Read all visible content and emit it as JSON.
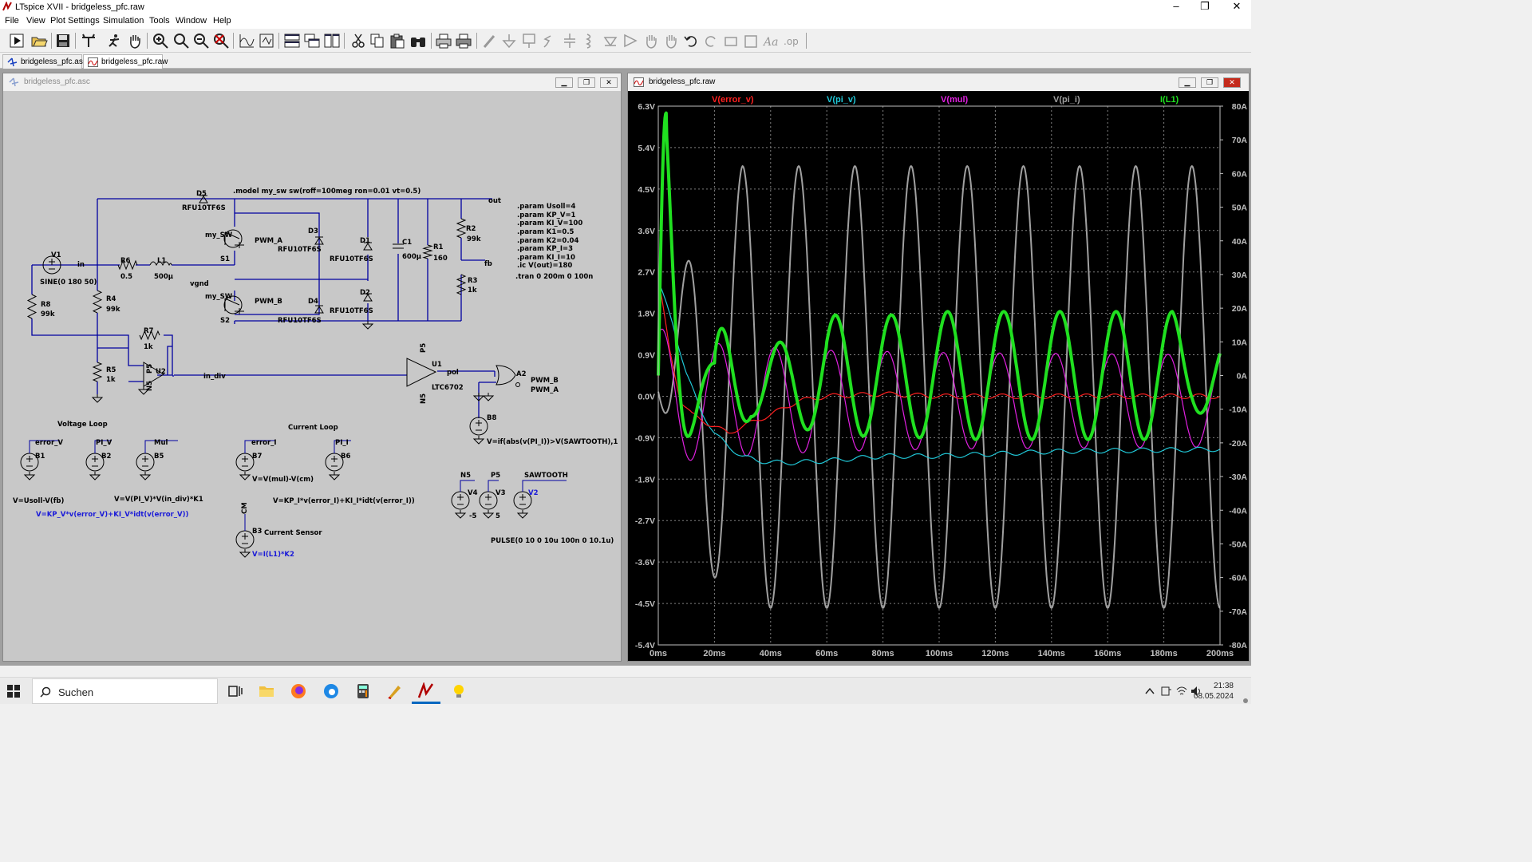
{
  "app": {
    "title": "LTspice XVII - bridgeless_pfc.raw"
  },
  "window_controls": {
    "minimize": "–",
    "maximize": "❐",
    "close": "✕"
  },
  "menu": [
    "File",
    "View",
    "Plot Settings",
    "Simulation",
    "Tools",
    "Window",
    "Help"
  ],
  "toolbar_icons": [
    "run-icon",
    "open-icon",
    "save-icon",
    "control-panel-icon",
    "halt-icon",
    "pan-icon",
    "zoom-in-icon",
    "zoom-to-fit-icon",
    "zoom-out-icon",
    "cancel-zoom-icon",
    "autorange-icon",
    "manual-limits-icon",
    "tile-horizontal-icon",
    "cascade-icon",
    "tile-vertical-icon",
    "cut-icon",
    "copy-icon",
    "paste-icon",
    "find-icon",
    "print-preview-icon",
    "print-icon",
    "wire-icon",
    "ground-icon",
    "label-icon",
    "resistor-icon",
    "capacitor-icon",
    "inductor-icon",
    "diode-icon",
    "component-icon",
    "move-icon",
    "drag-icon",
    "undo-icon",
    "redo-icon",
    "rotate-icon",
    "mirror-icon",
    "text-icon",
    "spice-directive-icon"
  ],
  "tabs": [
    {
      "label": "bridgeless_pfc.asc"
    },
    {
      "label": "bridgeless_pfc.raw"
    }
  ],
  "schematic": {
    "title": "bridgeless_pfc.asc",
    "texts": [
      ".model my_sw sw(roff=100meg ron=0.01 vt=0.5)",
      "D5",
      "RFU10TF6S",
      "out",
      ".param Usoll=4",
      ".param KP_V=1",
      ".param KI_V=100",
      ".param K1=0.5",
      ".param K2=0.04",
      ".param KP_I=3",
      ".param KI_I=10",
      ".ic V(out)=180",
      ".tran 0 200m 0 100n",
      "my_SW",
      "PWM_A",
      "S1",
      "D3",
      "RFU10TF6S",
      "D1",
      "RFU10TF6S",
      "C1",
      "600µ",
      "R1",
      "160",
      "R2",
      "99k",
      "fb",
      "R3",
      "1k",
      "V1",
      "in",
      "R6",
      "0.5",
      "L1",
      "500µ",
      "SINE(0 180 50)",
      "vgnd",
      "my_SW",
      "PWM_B",
      "S2",
      "D4",
      "RFU10TF6S",
      "D2",
      "RFU10TF6S",
      "R8",
      "99k",
      "R4",
      "99k",
      "R7",
      "1k",
      "R5",
      "1k",
      "U2",
      "in_div",
      "P5",
      "N5",
      "U1",
      "pol",
      "LTC6702",
      "P5",
      "N5",
      "A2",
      "PWM_B",
      "PWM_A",
      "B8",
      "V=if(abs(v(PI_I))>V(SAWTOOTH),1,0)",
      "Voltage Loop",
      "error_V",
      "B1",
      "PI_V",
      "B2",
      "Mul",
      "B5",
      "V=Usoll-V(fb)",
      "V=V(PI_V)*V(in_div)*K1",
      "V=KP_V*v(error_V)+KI_V*idt(v(error_V))",
      "Current Loop",
      "error_I",
      "B7",
      "PI_I",
      "B6",
      "V=V(mul)-V(cm)",
      "V=KP_I*v(error_I)+KI_I*idt(v(error_I))",
      "CM",
      "B3",
      "Current Sensor",
      "V=I(L1)*K2",
      "N5",
      "V4",
      "-5",
      "P5",
      "V3",
      "5",
      "SAWTOOTH",
      "V2",
      "PULSE(0 10 0 10u 100n 0 10.1u)"
    ]
  },
  "waveform": {
    "title": "bridgeless_pfc.raw",
    "legend": [
      {
        "label": "V(error_v)",
        "color": "#ff2020"
      },
      {
        "label": "V(pi_v)",
        "color": "#20c8d8"
      },
      {
        "label": "V(mul)",
        "color": "#e020e0"
      },
      {
        "label": "V(pi_i)",
        "color": "#a0a0a0"
      },
      {
        "label": "I(L1)",
        "color": "#20e020"
      }
    ]
  },
  "chart_data": {
    "type": "line",
    "x": {
      "label": "time",
      "min_ms": 0,
      "max_ms": 200,
      "ticks": [
        "0ms",
        "20ms",
        "40ms",
        "60ms",
        "80ms",
        "100ms",
        "120ms",
        "140ms",
        "160ms",
        "180ms",
        "200ms"
      ]
    },
    "y_left": {
      "min": -5.4,
      "max": 6.3,
      "unit": "V",
      "ticks": [
        "6.3V",
        "5.4V",
        "4.5V",
        "3.6V",
        "2.7V",
        "1.8V",
        "0.9V",
        "0.0V",
        "-0.9V",
        "-1.8V",
        "-2.7V",
        "-3.6V",
        "-4.5V",
        "-5.4V"
      ]
    },
    "y_right": {
      "min": -80,
      "max": 80,
      "unit": "A",
      "ticks": [
        "80A",
        "70A",
        "60A",
        "50A",
        "40A",
        "30A",
        "20A",
        "10A",
        "0A",
        "-10A",
        "-20A",
        "-30A",
        "-40A",
        "-50A",
        "-60A",
        "-70A",
        "-80A"
      ]
    },
    "grid": true,
    "series": [
      {
        "name": "V(error_v)",
        "axis": "left",
        "color": "#ff2020",
        "description_points": [
          [
            0,
            0.4
          ],
          [
            1,
            2.2
          ],
          [
            4,
            1.0
          ],
          [
            8,
            -0.1
          ],
          [
            12,
            -0.4
          ],
          [
            18,
            -0.6
          ],
          [
            25,
            -0.8
          ],
          [
            32,
            -0.6
          ],
          [
            40,
            -0.4
          ],
          [
            50,
            -0.1
          ],
          [
            60,
            0.0
          ],
          [
            80,
            0.05
          ],
          [
            100,
            0.0
          ],
          [
            140,
            0.0
          ],
          [
            200,
            0.0
          ]
        ]
      },
      {
        "name": "V(pi_v)",
        "axis": "left",
        "color": "#20c8d8",
        "points": [
          [
            0,
            2.5
          ],
          [
            5,
            1.6
          ],
          [
            10,
            0.5
          ],
          [
            15,
            -0.3
          ],
          [
            20,
            -0.8
          ],
          [
            25,
            -1.1
          ],
          [
            30,
            -1.3
          ],
          [
            35,
            -1.4
          ],
          [
            45,
            -1.45
          ],
          [
            60,
            -1.4
          ],
          [
            80,
            -1.3
          ],
          [
            100,
            -1.3
          ],
          [
            140,
            -1.2
          ],
          [
            200,
            -1.15
          ]
        ]
      },
      {
        "name": "V(mul)",
        "axis": "left",
        "color": "#e020e0",
        "amplitude": [
          [
            0,
            1.6
          ],
          [
            10,
            1.3
          ],
          [
            30,
            1.2
          ],
          [
            60,
            1.1
          ],
          [
            100,
            1.05
          ],
          [
            200,
            1.0
          ]
        ]
      },
      {
        "name": "V(pi_i)",
        "axis": "left",
        "color": "#a0a0a0",
        "amplitude": [
          [
            0,
            0.1
          ],
          [
            5,
            1.5
          ],
          [
            15,
            3.8
          ],
          [
            30,
            4.8
          ],
          [
            60,
            4.8
          ],
          [
            200,
            4.8
          ]
        ]
      },
      {
        "name": "I(L1)",
        "axis": "right",
        "color": "#20e020",
        "peaks": [
          [
            2.5,
            78
          ],
          [
            12,
            -38
          ],
          [
            23,
            22
          ],
          [
            33,
            -8
          ],
          [
            43,
            12
          ],
          [
            63,
            18
          ],
          [
            83,
            18
          ],
          [
            103,
            19
          ],
          [
            123,
            19
          ],
          [
            143,
            19
          ],
          [
            163,
            19
          ],
          [
            183,
            19
          ],
          [
            200,
            0
          ]
        ]
      }
    ]
  },
  "taskbar": {
    "search_placeholder": "Suchen",
    "time": "21:38",
    "date": "08.05.2024"
  }
}
